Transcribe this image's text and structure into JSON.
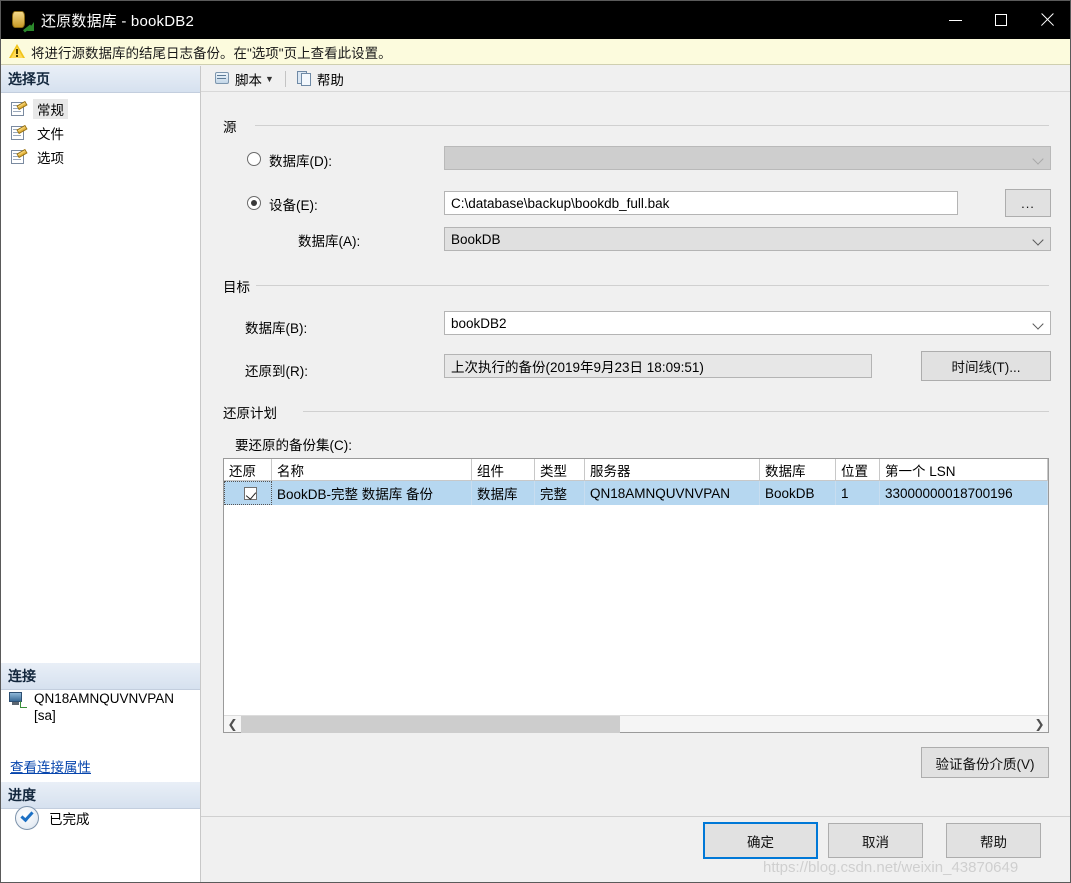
{
  "window": {
    "title": "还原数据库 - bookDB2",
    "icon": "restore-database-icon",
    "minimize_label": "最小化",
    "maximize_label": "最大化",
    "close_label": "关闭"
  },
  "warning": {
    "icon": "warning-icon",
    "text": "将进行源数据库的结尾日志备份。在\"选项\"页上查看此设置。"
  },
  "sidebar": {
    "select_page_header": "选择页",
    "items": [
      {
        "label": "常规",
        "selected": true
      },
      {
        "label": "文件",
        "selected": false
      },
      {
        "label": "选项",
        "selected": false
      }
    ],
    "connection_header": "连接",
    "connection_name": "QN18AMNQUVNVPAN [sa]",
    "connection_link": "查看连接属性",
    "progress_header": "进度",
    "progress_status": "已完成"
  },
  "toolbar": {
    "script_label": "脚本",
    "help_label": "帮助"
  },
  "source": {
    "group_title": "源",
    "database_radio_label": "数据库(D):",
    "database_radio_selected": false,
    "database_value": "",
    "device_radio_label": "设备(E):",
    "device_radio_selected": true,
    "device_path": "C:\\database\\backup\\bookdb_full.bak",
    "browse_label": "...",
    "device_database_label": "数据库(A):",
    "device_database_value": "BookDB"
  },
  "target": {
    "group_title": "目标",
    "database_label": "数据库(B):",
    "database_value": "bookDB2",
    "restore_to_label": "还原到(R):",
    "restore_to_value": "上次执行的备份(2019年9月23日 18:09:51)",
    "timeline_button": "时间线(T)..."
  },
  "restore_plan": {
    "group_title": "还原计划",
    "backup_sets_label": "要还原的备份集(C):",
    "columns": [
      "还原",
      "名称",
      "组件",
      "类型",
      "服务器",
      "数据库",
      "位置",
      "第一个 LSN"
    ],
    "rows": [
      {
        "restore_checked": true,
        "name": "BookDB-完整 数据库 备份",
        "component": "数据库",
        "type": "完整",
        "server": "QN18AMNQUVNVPAN",
        "database": "BookDB",
        "position": "1",
        "first_lsn": "33000000018700196"
      }
    ],
    "verify_button": "验证备份介质(V)"
  },
  "footer": {
    "ok_label": "确定",
    "cancel_label": "取消",
    "help_label": "帮助"
  },
  "watermark": "https://blog.csdn.net/weixin_43870649"
}
